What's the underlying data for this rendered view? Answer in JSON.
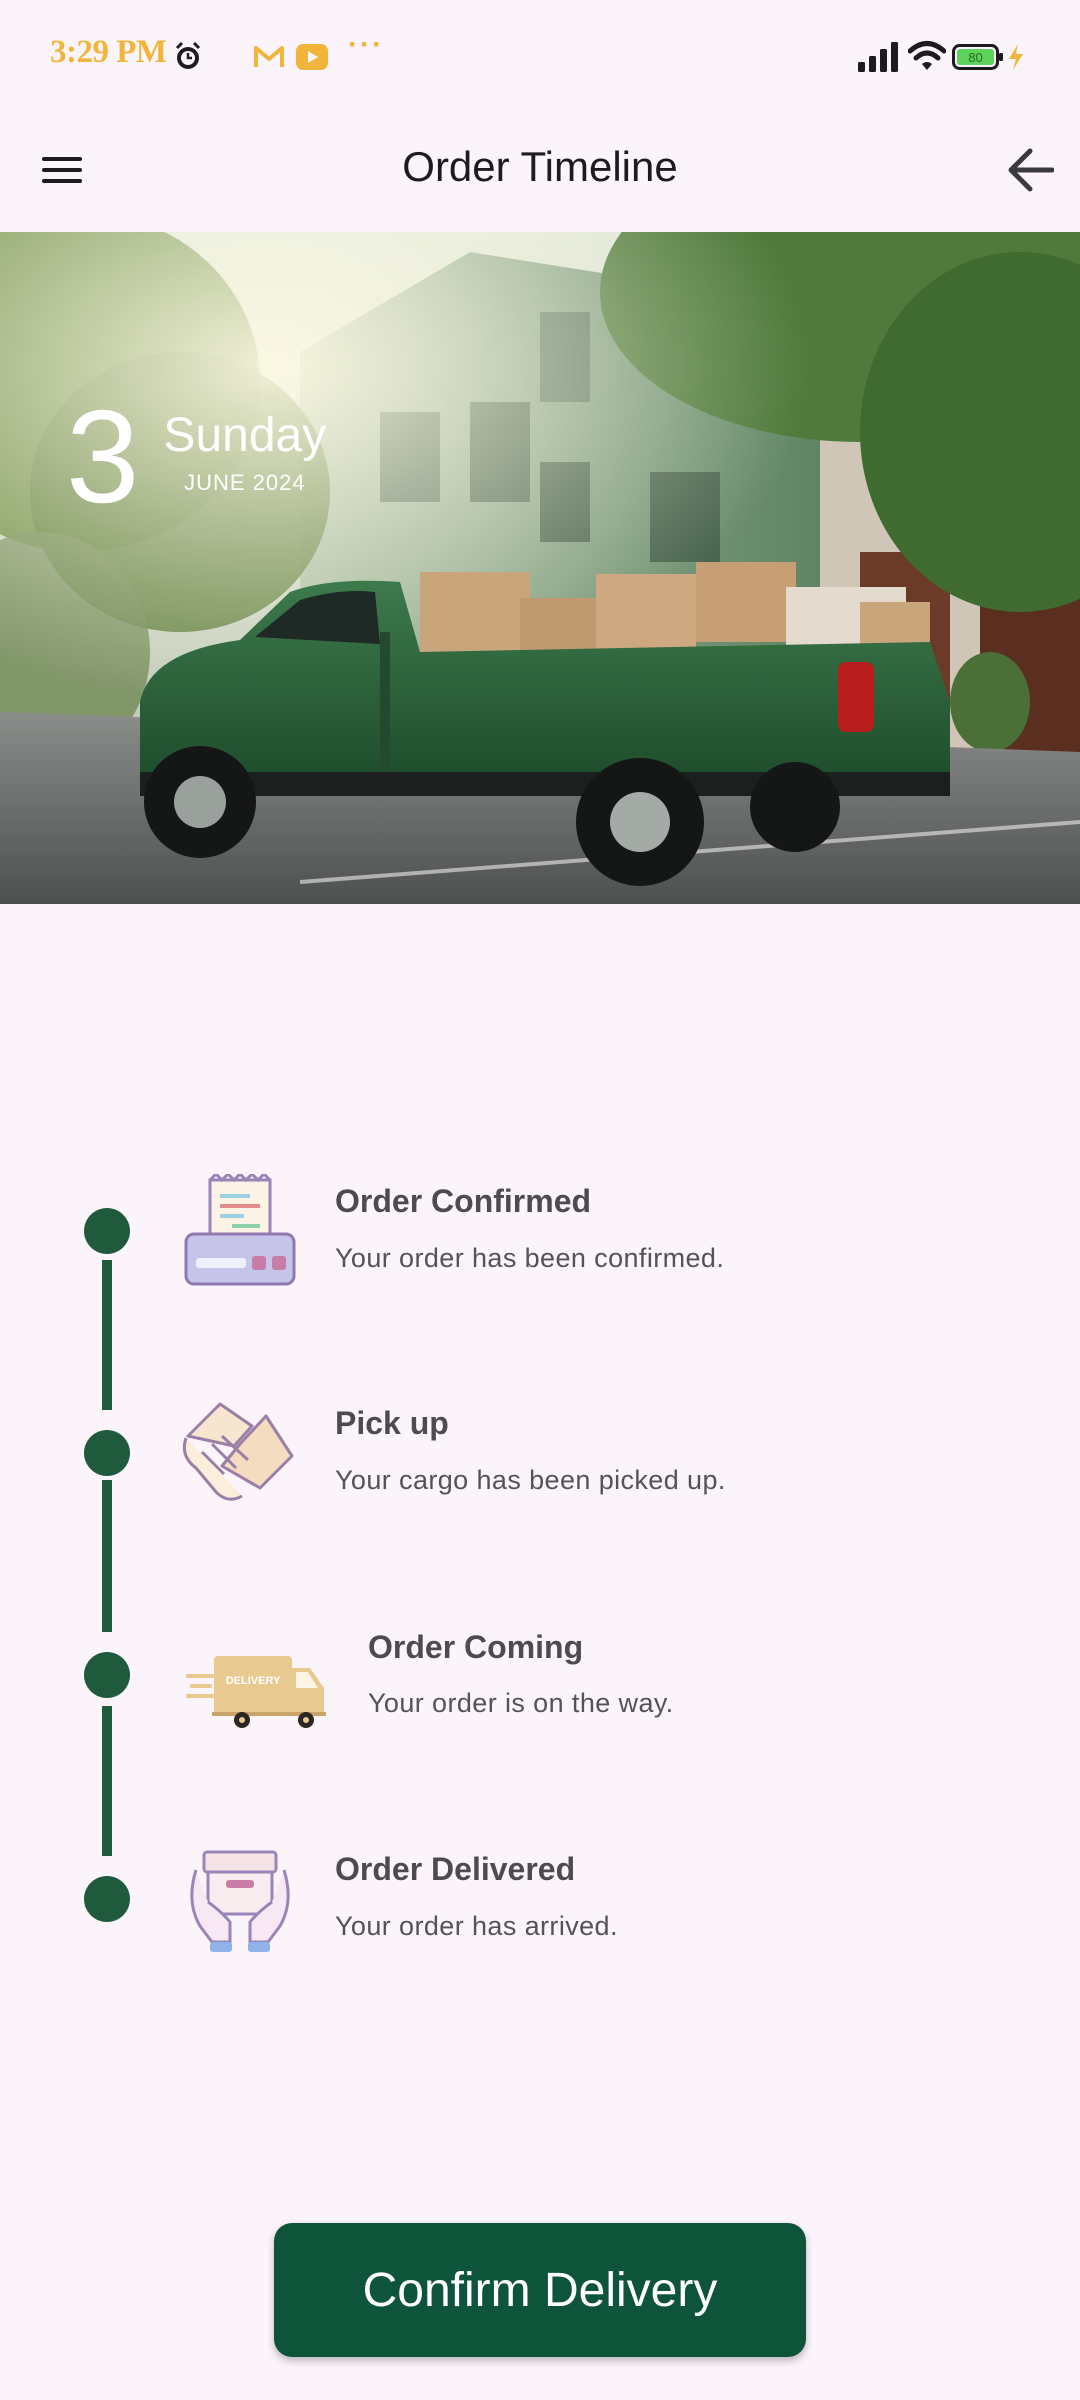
{
  "status_bar": {
    "time": "3:29 PM",
    "more": "···",
    "battery": "80"
  },
  "app_bar": {
    "title": "Order Timeline"
  },
  "hero": {
    "day_number": "3",
    "weekday": "Sunday",
    "month_year": "JUNE 2024"
  },
  "timeline": {
    "steps": [
      {
        "title": "Order Confirmed",
        "description": "Your order has been confirmed.",
        "icon": "receipt-printer-icon"
      },
      {
        "title": "Pick up",
        "description": "Your cargo has been picked up.",
        "icon": "handshake-icon"
      },
      {
        "title": "Order Coming",
        "description": "Your order is on the way.",
        "icon": "delivery-truck-icon",
        "truck_label": "DELIVERY"
      },
      {
        "title": "Order Delivered",
        "description": "Your order has arrived.",
        "icon": "package-in-hands-icon"
      }
    ]
  },
  "actions": {
    "confirm_label": "Confirm Delivery"
  },
  "colors": {
    "background": "#fcf4fb",
    "accent": "#0d543a",
    "timeline": "#1f5a3c",
    "status_accent": "#f2b53c"
  }
}
